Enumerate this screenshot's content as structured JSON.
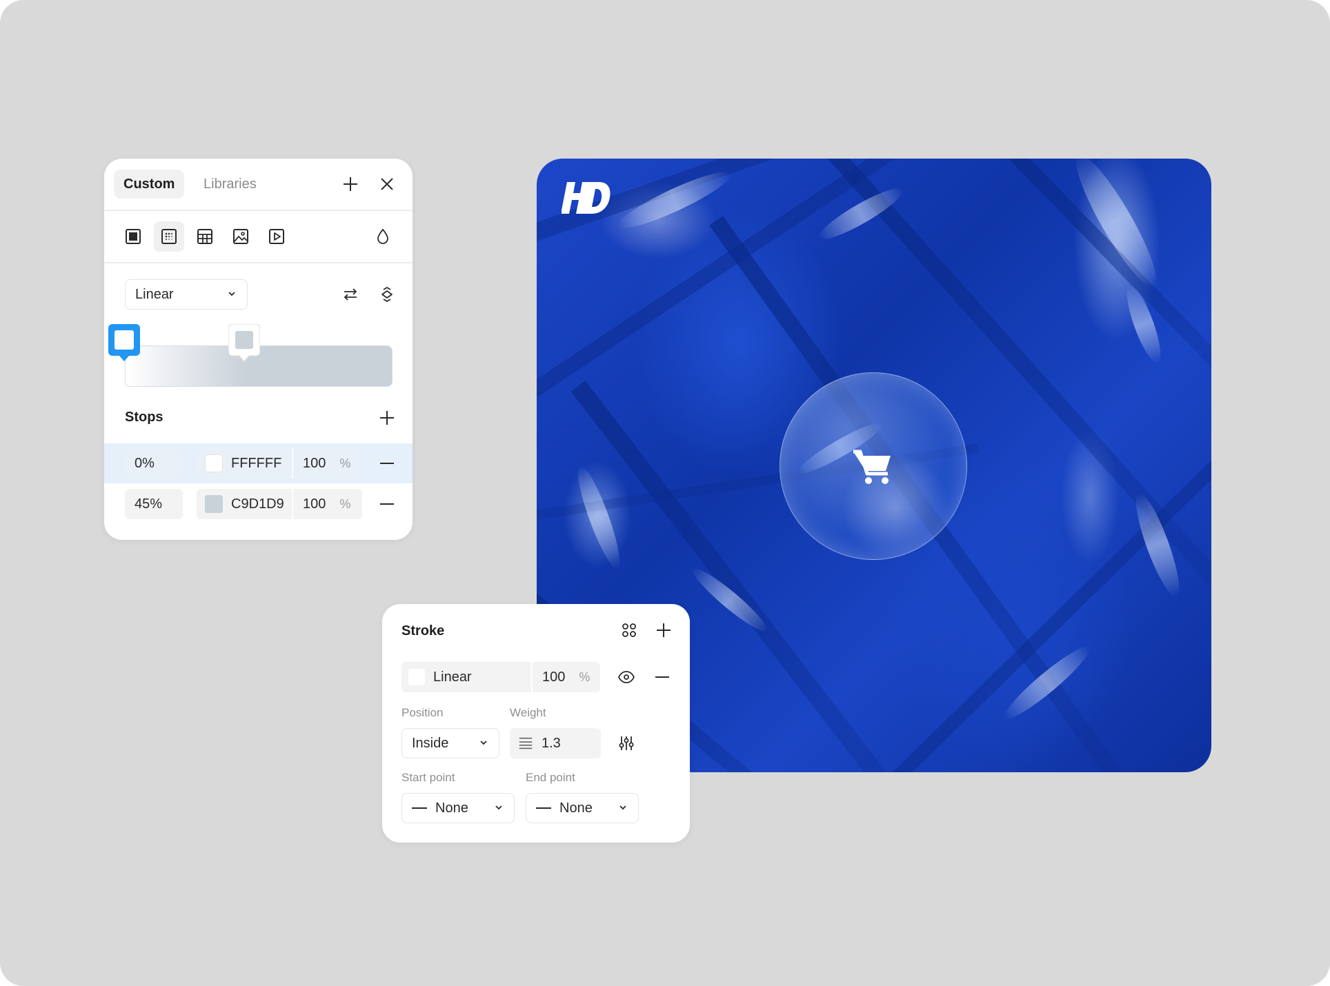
{
  "colors": {
    "background": "#d9d9d9",
    "panel": "#ffffff",
    "accent": "#2196f3",
    "stop_1": "#FFFFFF",
    "stop_2": "#C9D1D9"
  },
  "artwork": {
    "logo_text": "HD",
    "center_icon": "shopping-cart-icon"
  },
  "fill_panel": {
    "tabs": [
      {
        "label": "Custom",
        "active": true
      },
      {
        "label": "Libraries",
        "active": false
      }
    ],
    "header_icons": [
      "plus-icon",
      "close-icon"
    ],
    "fill_types": [
      "solid-fill-icon",
      "gradient-fill-icon",
      "pattern-fill-icon",
      "image-fill-icon",
      "video-fill-icon"
    ],
    "selected_fill_type": "gradient-fill-icon",
    "blend_icon": "drop-icon",
    "gradient_type": "Linear",
    "gradient_actions": [
      "swap-icon",
      "rotate-icon"
    ],
    "stops_title": "Stops",
    "stops": [
      {
        "position": "0%",
        "hex": "FFFFFF",
        "opacity": "100",
        "unit": "%",
        "selected": true
      },
      {
        "position": "45%",
        "hex": "C9D1D9",
        "opacity": "100",
        "unit": "%",
        "selected": false
      }
    ]
  },
  "stroke_panel": {
    "title": "Stroke",
    "header_icons": [
      "styles-grid-icon",
      "plus-icon"
    ],
    "paint": {
      "label": "Linear",
      "opacity": "100",
      "unit": "%"
    },
    "position_label": "Position",
    "position_value": "Inside",
    "weight_label": "Weight",
    "weight_value": "1.3",
    "start_label": "Start point",
    "start_value": "None",
    "end_label": "End point",
    "end_value": "None"
  }
}
